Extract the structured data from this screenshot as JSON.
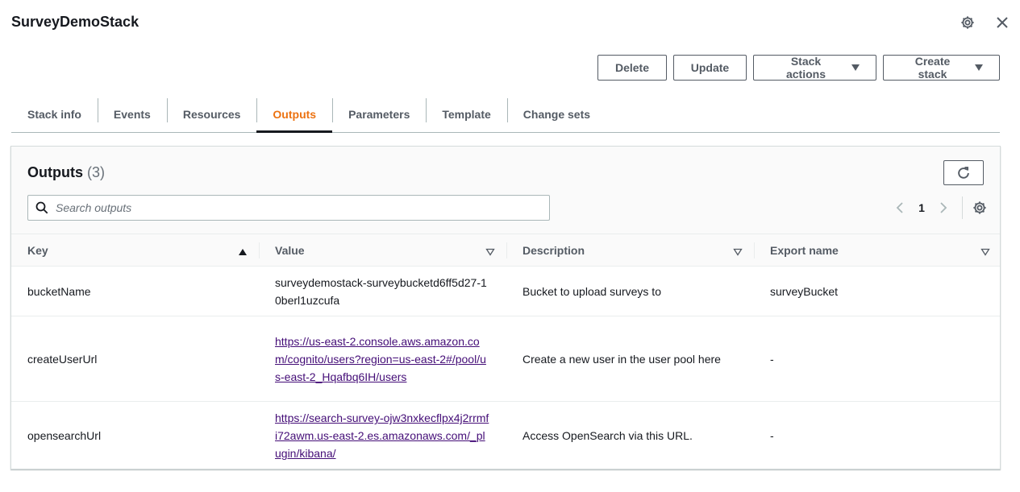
{
  "header": {
    "title": "SurveyDemoStack"
  },
  "toolbar": {
    "delete_label": "Delete",
    "update_label": "Update",
    "stack_actions_label": "Stack actions",
    "create_stack_label": "Create stack"
  },
  "tabs": [
    {
      "label": "Stack info"
    },
    {
      "label": "Events"
    },
    {
      "label": "Resources"
    },
    {
      "label": "Outputs",
      "active": true
    },
    {
      "label": "Parameters"
    },
    {
      "label": "Template"
    },
    {
      "label": "Change sets"
    }
  ],
  "outputs": {
    "title": "Outputs",
    "count": "(3)",
    "search_placeholder": "Search outputs",
    "page": "1",
    "columns": [
      "Key",
      "Value",
      "Description",
      "Export name"
    ],
    "rows": [
      {
        "key": "bucketName",
        "value": "surveydemostack-surveybucketd6ff5d27-10berl1uzcufa",
        "description": "Bucket to upload surveys to",
        "export": "surveyBucket"
      },
      {
        "key": "createUserUrl",
        "value": "https://us-east-2.console.aws.amazon.com/cognito/users?region=us-east-2#/pool/us-east-2_Hqafbq6IH/users",
        "description": "Create a new user in the user pool here",
        "export": "-"
      },
      {
        "key": "opensearchUrl",
        "value": "https://search-survey-ojw3nxkecflpx4j2rrmfi72awm.us-east-2.es.amazonaws.com/_plugin/kibana/",
        "description": "Access OpenSearch via this URL.",
        "export": "-"
      }
    ]
  },
  "colors": {
    "accent": "#ec7211",
    "link": "#440d77",
    "text": "#16191f",
    "muted": "#545b64"
  },
  "icons": [
    "settings-icon",
    "close-icon",
    "caret-down-icon",
    "refresh-icon",
    "search-icon",
    "chevron-left-icon",
    "chevron-right-icon",
    "sort-ascending-icon",
    "sort-filter-icon"
  ]
}
